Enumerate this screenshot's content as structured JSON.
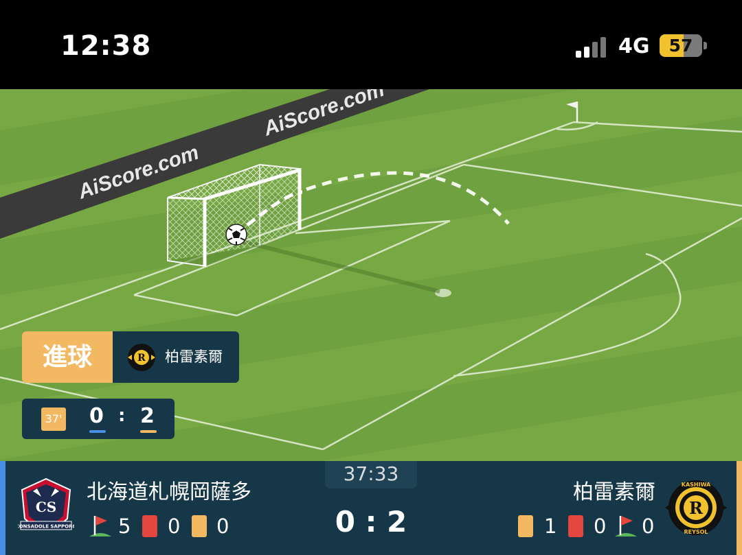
{
  "status_bar": {
    "time": "12:38",
    "network": "4G",
    "battery": "57",
    "battery_level": 0.57
  },
  "pitch": {
    "board_text_1": "AiScore.com",
    "board_text_2": "AiScore.com"
  },
  "goal_event": {
    "label": "進球",
    "team": "柏雷素爾"
  },
  "mini_score": {
    "minute": "37'",
    "home": "0",
    "separator": ":",
    "away": "2"
  },
  "match": {
    "clock": "37:33",
    "score": "0 : 2",
    "home": {
      "name": "北海道札幌岡薩多",
      "corners": "5",
      "red_cards": "0",
      "yellow_cards": "0"
    },
    "away": {
      "name": "柏雷素爾",
      "yellow_cards": "1",
      "red_cards": "0",
      "corners": "0"
    }
  },
  "colors": {
    "pitch_light": "#77a844",
    "pitch_dark": "#6a9a3c",
    "panel": "#163747",
    "accent_orange": "#f3b862",
    "accent_blue": "#4a8ee6",
    "red_card": "#e2463f",
    "yellow_card": "#f3b862"
  }
}
